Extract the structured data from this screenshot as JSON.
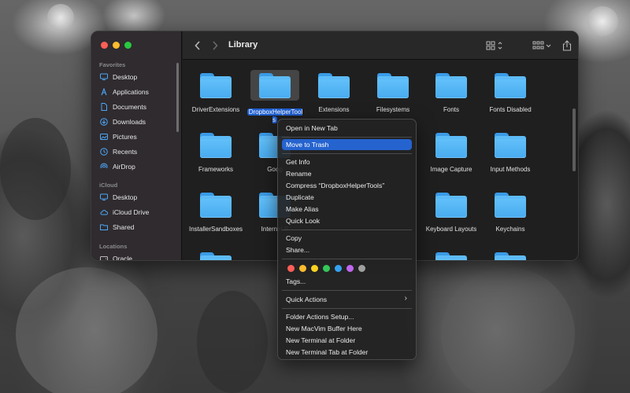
{
  "finder": {
    "title": "Library",
    "sidebar": {
      "sections": [
        {
          "label": "Favorites",
          "items": [
            "Desktop",
            "Applications",
            "Documents",
            "Downloads",
            "Pictures",
            "Recents",
            "AirDrop"
          ]
        },
        {
          "label": "iCloud",
          "items": [
            "Desktop",
            "iCloud Drive",
            "Shared"
          ]
        },
        {
          "label": "Locations",
          "items": [
            "Oracle"
          ]
        }
      ]
    },
    "folders": [
      {
        "name": "DriverExtensions"
      },
      {
        "name": "DropboxHelperTools"
      },
      {
        "name": "Extensions"
      },
      {
        "name": "Filesystems"
      },
      {
        "name": "Fonts"
      },
      {
        "name": "Fonts Disabled"
      },
      {
        "name": "Frameworks"
      },
      {
        "name": "Goog"
      },
      {
        "name": ""
      },
      {
        "name": ""
      },
      {
        "name": "Image Capture"
      },
      {
        "name": "Input Methods"
      },
      {
        "name": "InstallerSandboxes"
      },
      {
        "name": "Internet P"
      },
      {
        "name": ""
      },
      {
        "name": ""
      },
      {
        "name": "Keyboard Layouts"
      },
      {
        "name": "Keychains"
      }
    ],
    "selected_folder": "DropboxHelperTools"
  },
  "context_menu": {
    "items": [
      {
        "label": "Open in New Tab"
      },
      {
        "label": "Move to Trash",
        "active": true
      },
      {
        "label": "Get Info"
      },
      {
        "label": "Rename"
      },
      {
        "label": "Compress “DropboxHelperTools”"
      },
      {
        "label": "Duplicate"
      },
      {
        "label": "Make Alias"
      },
      {
        "label": "Quick Look"
      },
      {
        "label": "Copy"
      },
      {
        "label": "Share..."
      },
      {
        "label": "Tags..."
      },
      {
        "label": "Quick Actions",
        "submenu": true
      },
      {
        "label": "Folder Actions Setup..."
      },
      {
        "label": "New MacVim Buffer Here"
      },
      {
        "label": "New Terminal at Folder"
      },
      {
        "label": "New Terminal Tab at Folder"
      }
    ],
    "tag_colors": [
      "#ff5f57",
      "#febc2e",
      "#f7d21f",
      "#34c759",
      "#34a3f0",
      "#c067f0",
      "#a0a0a0"
    ],
    "submenu_glyph": "›"
  },
  "icons": {
    "colors": {
      "accent": "#2563cf",
      "folder": "#4fb2f2"
    }
  }
}
